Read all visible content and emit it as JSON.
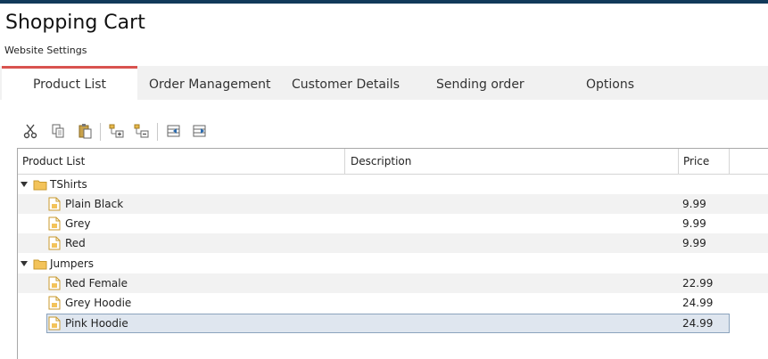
{
  "app": {
    "title": "Shopping Cart",
    "subtitle": "Website Settings"
  },
  "tabs": [
    {
      "label": "Product List",
      "active": true
    },
    {
      "label": "Order Management",
      "active": false
    },
    {
      "label": "Customer Details",
      "active": false
    },
    {
      "label": "Sending order",
      "active": false
    },
    {
      "label": "Options",
      "active": false
    }
  ],
  "toolbar": {
    "icons": [
      "cut-icon",
      "copy-icon",
      "paste-icon",
      "add-child-icon",
      "remove-child-icon",
      "indent-icon",
      "outdent-icon"
    ]
  },
  "grid": {
    "columns": [
      "Product List",
      "Description",
      "Price"
    ],
    "groups": [
      {
        "name": "TShirts",
        "expanded": true,
        "items": [
          {
            "name": "Plain Black",
            "description": "",
            "price": "9.99"
          },
          {
            "name": "Grey",
            "description": "",
            "price": "9.99"
          },
          {
            "name": "Red",
            "description": "",
            "price": "9.99"
          }
        ]
      },
      {
        "name": "Jumpers",
        "expanded": true,
        "items": [
          {
            "name": "Red Female",
            "description": "",
            "price": "22.99"
          },
          {
            "name": "Grey Hoodie",
            "description": "",
            "price": "24.99"
          },
          {
            "name": "Pink Hoodie",
            "description": "",
            "price": "24.99",
            "selected": true
          }
        ]
      }
    ]
  },
  "colors": {
    "accent": "#d9534f",
    "topbar": "#123a5a",
    "selection": "#dfe6ef",
    "folder": "#f3c35a"
  }
}
